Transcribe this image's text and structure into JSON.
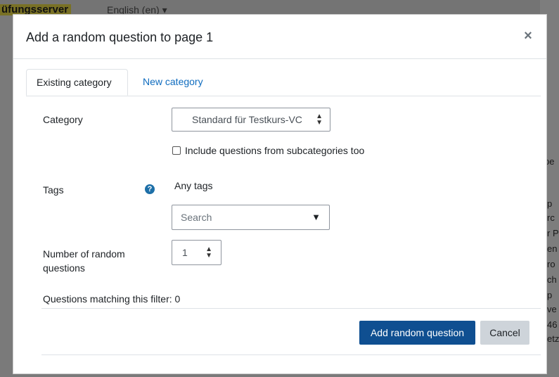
{
  "background": {
    "site_name": "üfungsserver",
    "language": "English (en) ▾",
    "right_fragments": [
      "pe",
      "p",
      "rc",
      "r P",
      "en",
      "ro",
      "ch",
      "p",
      "ve",
      "46",
      "etz"
    ]
  },
  "modal": {
    "title": "Add a random question to page 1",
    "close": "×",
    "tabs": [
      "Existing category",
      "New category"
    ],
    "category_label": "Category",
    "category_value": "Standard für Testkurs-VC",
    "subcategories_label": "Include questions from subcategories too",
    "tags_label": "Tags",
    "tags_value": "Any tags",
    "search_placeholder": "Search",
    "number_label_line1": "Number of random",
    "number_label_line2": "questions",
    "number_value": "1",
    "matching": "Questions matching this filter: 0",
    "add_button": "Add random question",
    "cancel_button": "Cancel"
  }
}
